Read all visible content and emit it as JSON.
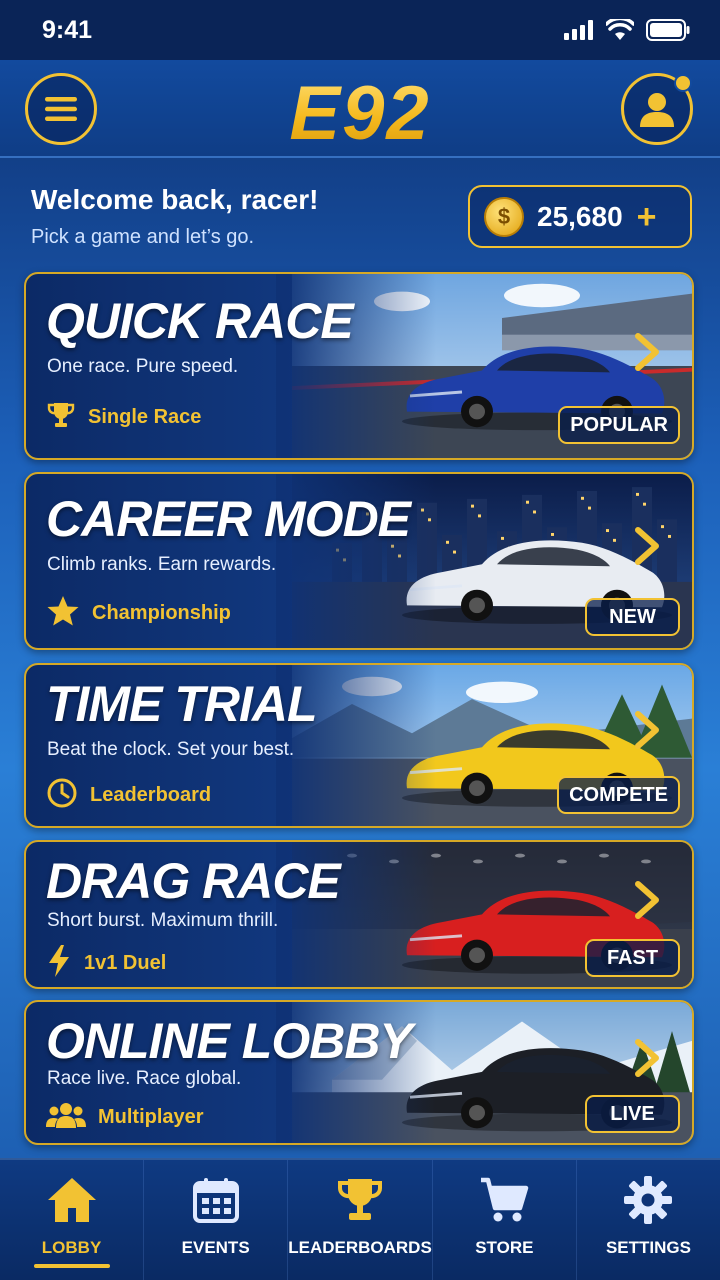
{
  "status_bar": {
    "time": "9:41"
  },
  "header": {
    "logo": "E92"
  },
  "welcome": {
    "title": "Welcome back, racer!",
    "subtitle": "Pick a game and let’s go.",
    "coins": "25,680",
    "coin_symbol": "$",
    "add_symbol": "+"
  },
  "modes": [
    {
      "title": "QUICK RACE",
      "subtitle": "One race. Pure speed.",
      "tag": "Single Race",
      "tag_icon": "trophy-icon",
      "badge": "POPULAR",
      "car_color": "#1f3fa8"
    },
    {
      "title": "CAREER MODE",
      "subtitle": "Climb ranks. Earn rewards.",
      "tag": "Championship",
      "tag_icon": "star-icon",
      "badge": "NEW",
      "car_color": "#e8ecf2"
    },
    {
      "title": "TIME TRIAL",
      "subtitle": "Beat the clock. Set your best.",
      "tag": "Leaderboard",
      "tag_icon": "clock-icon",
      "badge": "COMPETE",
      "car_color": "#f2c81c"
    },
    {
      "title": "DRAG RACE",
      "subtitle": "Short burst. Maximum thrill.",
      "tag": "1v1 Duel",
      "tag_icon": "lightning-icon",
      "badge": "FAST",
      "car_color": "#d81f1f"
    },
    {
      "title": "ONLINE LOBBY",
      "subtitle": "Race live. Race global.",
      "tag": "Multiplayer",
      "tag_icon": "users-icon",
      "badge": "LIVE",
      "car_color": "#1c1f26"
    }
  ],
  "nav": [
    {
      "label": "LOBBY",
      "icon": "home-icon",
      "active": true
    },
    {
      "label": "EVENTS",
      "icon": "calendar-icon",
      "active": false
    },
    {
      "label": "LEADERBOARDS",
      "icon": "trophy-icon",
      "active": false
    },
    {
      "label": "STORE",
      "icon": "cart-icon",
      "active": false
    },
    {
      "label": "SETTINGS",
      "icon": "gear-icon",
      "active": false
    }
  ],
  "colors": {
    "accent": "#f2c233",
    "background": "#1c5fb8"
  }
}
